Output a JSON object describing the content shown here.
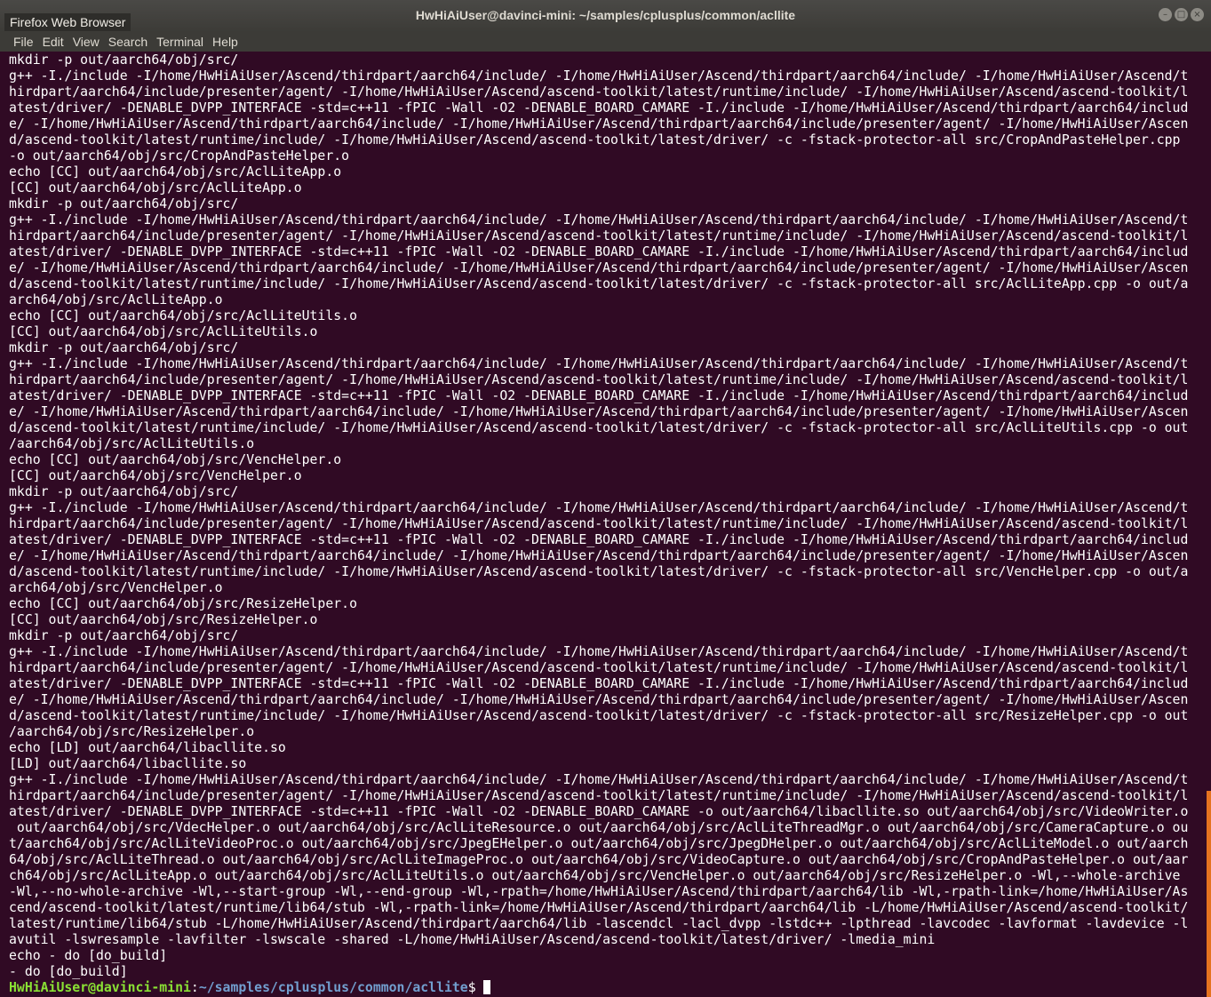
{
  "window": {
    "title": "HwHiAiUser@davinci-mini: ~/samples/cplusplus/common/acllite",
    "app_label": "Firefox Web Browser"
  },
  "menu": [
    "File",
    "Edit",
    "View",
    "Search",
    "Terminal",
    "Help"
  ],
  "window_buttons": [
    "minimize",
    "maximize",
    "close"
  ],
  "terminal": {
    "lines": [
      "mkdir -p out/aarch64/obj/src/",
      "g++ -I./include -I/home/HwHiAiUser/Ascend/thirdpart/aarch64/include/ -I/home/HwHiAiUser/Ascend/thirdpart/aarch64/include/ -I/home/HwHiAiUser/Ascend/t",
      "hirdpart/aarch64/include/presenter/agent/ -I/home/HwHiAiUser/Ascend/ascend-toolkit/latest/runtime/include/ -I/home/HwHiAiUser/Ascend/ascend-toolkit/l",
      "atest/driver/ -DENABLE_DVPP_INTERFACE -std=c++11 -fPIC -Wall -O2 -DENABLE_BOARD_CAMARE -I./include -I/home/HwHiAiUser/Ascend/thirdpart/aarch64/includ",
      "e/ -I/home/HwHiAiUser/Ascend/thirdpart/aarch64/include/ -I/home/HwHiAiUser/Ascend/thirdpart/aarch64/include/presenter/agent/ -I/home/HwHiAiUser/Ascen",
      "d/ascend-toolkit/latest/runtime/include/ -I/home/HwHiAiUser/Ascend/ascend-toolkit/latest/driver/ -c -fstack-protector-all src/CropAndPasteHelper.cpp",
      "-o out/aarch64/obj/src/CropAndPasteHelper.o",
      "echo [CC] out/aarch64/obj/src/AclLiteApp.o",
      "[CC] out/aarch64/obj/src/AclLiteApp.o",
      "mkdir -p out/aarch64/obj/src/",
      "g++ -I./include -I/home/HwHiAiUser/Ascend/thirdpart/aarch64/include/ -I/home/HwHiAiUser/Ascend/thirdpart/aarch64/include/ -I/home/HwHiAiUser/Ascend/t",
      "hirdpart/aarch64/include/presenter/agent/ -I/home/HwHiAiUser/Ascend/ascend-toolkit/latest/runtime/include/ -I/home/HwHiAiUser/Ascend/ascend-toolkit/l",
      "atest/driver/ -DENABLE_DVPP_INTERFACE -std=c++11 -fPIC -Wall -O2 -DENABLE_BOARD_CAMARE -I./include -I/home/HwHiAiUser/Ascend/thirdpart/aarch64/includ",
      "e/ -I/home/HwHiAiUser/Ascend/thirdpart/aarch64/include/ -I/home/HwHiAiUser/Ascend/thirdpart/aarch64/include/presenter/agent/ -I/home/HwHiAiUser/Ascen",
      "d/ascend-toolkit/latest/runtime/include/ -I/home/HwHiAiUser/Ascend/ascend-toolkit/latest/driver/ -c -fstack-protector-all src/AclLiteApp.cpp -o out/a",
      "arch64/obj/src/AclLiteApp.o",
      "echo [CC] out/aarch64/obj/src/AclLiteUtils.o",
      "[CC] out/aarch64/obj/src/AclLiteUtils.o",
      "mkdir -p out/aarch64/obj/src/",
      "g++ -I./include -I/home/HwHiAiUser/Ascend/thirdpart/aarch64/include/ -I/home/HwHiAiUser/Ascend/thirdpart/aarch64/include/ -I/home/HwHiAiUser/Ascend/t",
      "hirdpart/aarch64/include/presenter/agent/ -I/home/HwHiAiUser/Ascend/ascend-toolkit/latest/runtime/include/ -I/home/HwHiAiUser/Ascend/ascend-toolkit/l",
      "atest/driver/ -DENABLE_DVPP_INTERFACE -std=c++11 -fPIC -Wall -O2 -DENABLE_BOARD_CAMARE -I./include -I/home/HwHiAiUser/Ascend/thirdpart/aarch64/includ",
      "e/ -I/home/HwHiAiUser/Ascend/thirdpart/aarch64/include/ -I/home/HwHiAiUser/Ascend/thirdpart/aarch64/include/presenter/agent/ -I/home/HwHiAiUser/Ascen",
      "d/ascend-toolkit/latest/runtime/include/ -I/home/HwHiAiUser/Ascend/ascend-toolkit/latest/driver/ -c -fstack-protector-all src/AclLiteUtils.cpp -o out",
      "/aarch64/obj/src/AclLiteUtils.o",
      "echo [CC] out/aarch64/obj/src/VencHelper.o",
      "[CC] out/aarch64/obj/src/VencHelper.o",
      "mkdir -p out/aarch64/obj/src/",
      "g++ -I./include -I/home/HwHiAiUser/Ascend/thirdpart/aarch64/include/ -I/home/HwHiAiUser/Ascend/thirdpart/aarch64/include/ -I/home/HwHiAiUser/Ascend/t",
      "hirdpart/aarch64/include/presenter/agent/ -I/home/HwHiAiUser/Ascend/ascend-toolkit/latest/runtime/include/ -I/home/HwHiAiUser/Ascend/ascend-toolkit/l",
      "atest/driver/ -DENABLE_DVPP_INTERFACE -std=c++11 -fPIC -Wall -O2 -DENABLE_BOARD_CAMARE -I./include -I/home/HwHiAiUser/Ascend/thirdpart/aarch64/includ",
      "e/ -I/home/HwHiAiUser/Ascend/thirdpart/aarch64/include/ -I/home/HwHiAiUser/Ascend/thirdpart/aarch64/include/presenter/agent/ -I/home/HwHiAiUser/Ascen",
      "d/ascend-toolkit/latest/runtime/include/ -I/home/HwHiAiUser/Ascend/ascend-toolkit/latest/driver/ -c -fstack-protector-all src/VencHelper.cpp -o out/a",
      "arch64/obj/src/VencHelper.o",
      "echo [CC] out/aarch64/obj/src/ResizeHelper.o",
      "[CC] out/aarch64/obj/src/ResizeHelper.o",
      "mkdir -p out/aarch64/obj/src/",
      "g++ -I./include -I/home/HwHiAiUser/Ascend/thirdpart/aarch64/include/ -I/home/HwHiAiUser/Ascend/thirdpart/aarch64/include/ -I/home/HwHiAiUser/Ascend/t",
      "hirdpart/aarch64/include/presenter/agent/ -I/home/HwHiAiUser/Ascend/ascend-toolkit/latest/runtime/include/ -I/home/HwHiAiUser/Ascend/ascend-toolkit/l",
      "atest/driver/ -DENABLE_DVPP_INTERFACE -std=c++11 -fPIC -Wall -O2 -DENABLE_BOARD_CAMARE -I./include -I/home/HwHiAiUser/Ascend/thirdpart/aarch64/includ",
      "e/ -I/home/HwHiAiUser/Ascend/thirdpart/aarch64/include/ -I/home/HwHiAiUser/Ascend/thirdpart/aarch64/include/presenter/agent/ -I/home/HwHiAiUser/Ascen",
      "d/ascend-toolkit/latest/runtime/include/ -I/home/HwHiAiUser/Ascend/ascend-toolkit/latest/driver/ -c -fstack-protector-all src/ResizeHelper.cpp -o out",
      "/aarch64/obj/src/ResizeHelper.o",
      "echo [LD] out/aarch64/libacllite.so",
      "[LD] out/aarch64/libacllite.so",
      "g++ -I./include -I/home/HwHiAiUser/Ascend/thirdpart/aarch64/include/ -I/home/HwHiAiUser/Ascend/thirdpart/aarch64/include/ -I/home/HwHiAiUser/Ascend/t",
      "hirdpart/aarch64/include/presenter/agent/ -I/home/HwHiAiUser/Ascend/ascend-toolkit/latest/runtime/include/ -I/home/HwHiAiUser/Ascend/ascend-toolkit/l",
      "atest/driver/ -DENABLE_DVPP_INTERFACE -std=c++11 -fPIC -Wall -O2 -DENABLE_BOARD_CAMARE -o out/aarch64/libacllite.so out/aarch64/obj/src/VideoWriter.o",
      " out/aarch64/obj/src/VdecHelper.o out/aarch64/obj/src/AclLiteResource.o out/aarch64/obj/src/AclLiteThreadMgr.o out/aarch64/obj/src/CameraCapture.o ou",
      "t/aarch64/obj/src/AclLiteVideoProc.o out/aarch64/obj/src/JpegEHelper.o out/aarch64/obj/src/JpegDHelper.o out/aarch64/obj/src/AclLiteModel.o out/aarch",
      "64/obj/src/AclLiteThread.o out/aarch64/obj/src/AclLiteImageProc.o out/aarch64/obj/src/VideoCapture.o out/aarch64/obj/src/CropAndPasteHelper.o out/aar",
      "ch64/obj/src/AclLiteApp.o out/aarch64/obj/src/AclLiteUtils.o out/aarch64/obj/src/VencHelper.o out/aarch64/obj/src/ResizeHelper.o -Wl,--whole-archive",
      "-Wl,--no-whole-archive -Wl,--start-group -Wl,--end-group -Wl,-rpath=/home/HwHiAiUser/Ascend/thirdpart/aarch64/lib -Wl,-rpath-link=/home/HwHiAiUser/As",
      "cend/ascend-toolkit/latest/runtime/lib64/stub -Wl,-rpath-link=/home/HwHiAiUser/Ascend/thirdpart/aarch64/lib -L/home/HwHiAiUser/Ascend/ascend-toolkit/",
      "latest/runtime/lib64/stub -L/home/HwHiAiUser/Ascend/thirdpart/aarch64/lib -lascendcl -lacl_dvpp -lstdc++ -lpthread -lavcodec -lavformat -lavdevice -l",
      "avutil -lswresample -lavfilter -lswscale -shared -L/home/HwHiAiUser/Ascend/ascend-toolkit/latest/driver/ -lmedia_mini",
      "echo - do [do_build]",
      "- do [do_build]"
    ],
    "prompt": {
      "user_host": "HwHiAiUser@davinci-mini",
      "separator": ":",
      "path": "~/samples/cplusplus/common/acllite",
      "symbol": "$"
    }
  },
  "colors": {
    "terminal_bg": "#300a24",
    "terminal_fg": "#ffffff",
    "prompt_user": "#8ae234",
    "prompt_path": "#729fcf",
    "titlebar": "#3c3b37",
    "scrollbar_accent": "#e5731f"
  }
}
